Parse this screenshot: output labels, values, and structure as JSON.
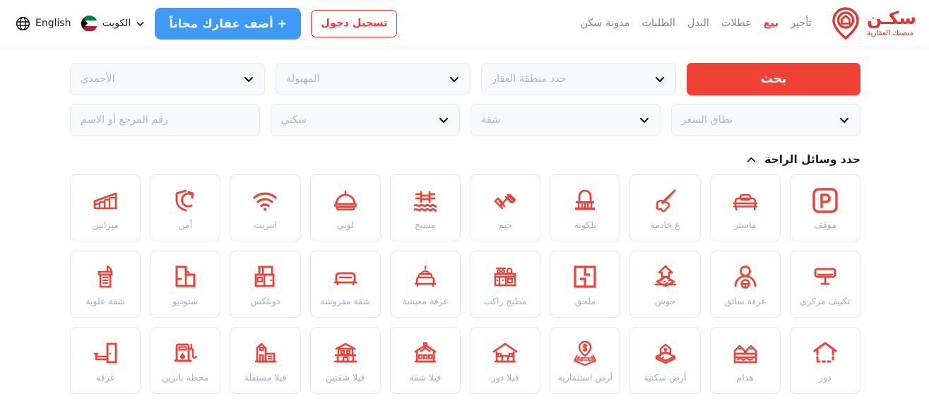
{
  "brand": {
    "name": "سكـن",
    "tagline": "منصتك العقارية",
    "color": "#e8312a",
    "logo_icon": "location-pin-home-logo"
  },
  "nav": {
    "items": [
      {
        "label": "تأجير",
        "active": false
      },
      {
        "label": "بيع",
        "active": true
      },
      {
        "label": "عطلات",
        "active": false
      },
      {
        "label": "البدل",
        "active": false
      },
      {
        "label": "الطلبات",
        "active": false
      },
      {
        "label": "مدونة سكن",
        "active": false
      }
    ]
  },
  "header": {
    "language_label": "English",
    "language_icon": "globe-icon",
    "country_label": "الكويت",
    "country_flag_icon": "kuwait-flag-icon",
    "country_chevron_icon": "chevron-down-icon",
    "add_property_label": "+ أضف عقارك مجاناً",
    "add_property_color": "#3d9bf7",
    "login_label": "تسجيل دخول",
    "login_color": "#ef3b36"
  },
  "search": {
    "row1": [
      {
        "name": "governorate",
        "value": "الأحمدي",
        "icon": "chevron-down-icon"
      },
      {
        "name": "city",
        "value": "المهبولة",
        "icon": "chevron-down-icon"
      },
      {
        "name": "area",
        "value": "حدد منطقة العقار",
        "icon": "chevron-down-icon"
      }
    ],
    "search_button_label": "بحث",
    "search_button_color": "#ef4136",
    "row2": [
      {
        "name": "reference",
        "value": "رقم المرجع أو الاسم",
        "icon": ""
      },
      {
        "name": "purpose",
        "value": "سكني",
        "icon": "chevron-down-icon"
      },
      {
        "name": "property-type",
        "value": "شقة",
        "icon": "chevron-down-icon"
      },
      {
        "name": "price-range",
        "value": "نطاق السعر",
        "icon": "chevron-down-icon"
      }
    ]
  },
  "amenities": {
    "title": "حدد وسائل الراحة",
    "toggle_icon": "chevron-up-icon",
    "accent_color": "#ef4136",
    "rows": [
      [
        {
          "label": "موقف",
          "icon": "parking-p-icon"
        },
        {
          "label": "ماستر",
          "icon": "bed-icon"
        },
        {
          "label": "غ خادمة",
          "icon": "feather-duster-icon"
        },
        {
          "label": "بلكونة",
          "icon": "balcony-icon"
        },
        {
          "label": "جيم",
          "icon": "dumbbell-icon"
        },
        {
          "label": "مسبح",
          "icon": "swimming-pool-icon"
        },
        {
          "label": "لوبي",
          "icon": "service-bell-icon"
        },
        {
          "label": "انترنت",
          "icon": "wifi-icon"
        },
        {
          "label": "أمن",
          "icon": "shield-security-icon"
        },
        {
          "label": "ميزانين",
          "icon": "stairs-icon"
        }
      ],
      [
        {
          "label": "تكييف مركزي",
          "icon": "air-conditioner-icon"
        },
        {
          "label": "غرفة سائق",
          "icon": "driver-icon"
        },
        {
          "label": "حوش",
          "icon": "courtyard-house-icon"
        },
        {
          "label": "ملحق",
          "icon": "floor-plan-annex-icon"
        },
        {
          "label": "مطبخ راكب",
          "icon": "kitchen-icon"
        },
        {
          "label": "غرفة معيشة",
          "icon": "sofa-lamp-icon"
        },
        {
          "label": "شقة مفروشة",
          "icon": "sofa-icon"
        },
        {
          "label": "دوبلكس",
          "icon": "duplex-icon"
        },
        {
          "label": "ستوديو",
          "icon": "studio-floorplan-icon"
        },
        {
          "label": "شقة علوية",
          "icon": "penthouse-icon"
        }
      ],
      [
        {
          "label": "دور",
          "icon": "floor-house-dashed-icon"
        },
        {
          "label": "هدام",
          "icon": "demolition-icon"
        },
        {
          "label": "أرض سكنية",
          "icon": "residential-land-icon"
        },
        {
          "label": "أرض استثمارية",
          "icon": "investment-land-icon"
        },
        {
          "label": "فيلا دور",
          "icon": "villa-floor-icon"
        },
        {
          "label": "فيلا شقة",
          "icon": "villa-apartment-icon"
        },
        {
          "label": "فيلا شقتين",
          "icon": "villa-two-apartments-icon"
        },
        {
          "label": "فيلا مستقلة",
          "icon": "standalone-villa-icon"
        },
        {
          "label": "محطة بانزين",
          "icon": "gas-station-icon"
        },
        {
          "label": "غرفة",
          "icon": "room-door-bed-icon"
        }
      ]
    ]
  }
}
